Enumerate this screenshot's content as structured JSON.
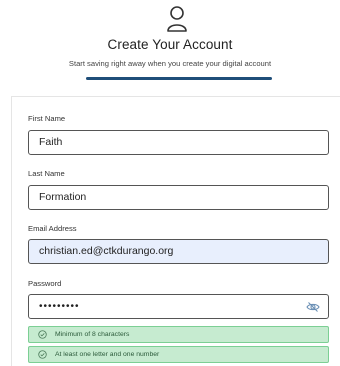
{
  "header": {
    "icon": "user-icon",
    "title": "Create Your Account",
    "subtitle": "Start saving right away when you create your digital account",
    "accent": "#1f4e79"
  },
  "form": {
    "first_name": {
      "label": "First Name",
      "value": "Faith"
    },
    "last_name": {
      "label": "Last Name",
      "value": "Formation"
    },
    "email": {
      "label": "Email Address",
      "value": "christian.ed@ctkdurango.org"
    },
    "password": {
      "label": "Password",
      "value": "•••••••••",
      "icon": "eye-slash-icon"
    }
  },
  "requirements": [
    {
      "text": "Minimum of 8 characters",
      "met": true,
      "icon": "check-circle-icon"
    },
    {
      "text": "At least one letter and one number",
      "met": true,
      "icon": "check-circle-icon"
    }
  ],
  "colors": {
    "field_filled_bg": "#e8effd",
    "requirement_bg": "#c6ebd0",
    "requirement_border": "#7ccf94"
  }
}
